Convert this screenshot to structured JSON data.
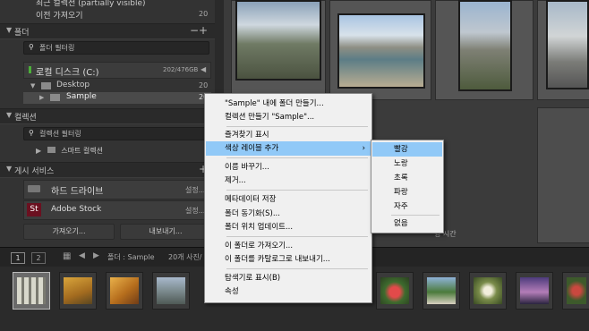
{
  "left_panel": {
    "top_rows": [
      {
        "label": "최근 컬렉션 (partially visible)",
        "count": ""
      },
      {
        "label": "이전 가져오기",
        "count": "20"
      }
    ],
    "folders": {
      "title": "폴더",
      "add": "+",
      "minus": "−",
      "filter": "폴더 필터링",
      "volume": {
        "name": "로컬 디스크 (C:)",
        "size": "202/476GB"
      },
      "items": [
        {
          "name": "Desktop",
          "count": "20"
        },
        {
          "name": "Sample",
          "count": "20"
        }
      ]
    },
    "collections": {
      "title": "컬렉션",
      "filter": "컬렉션 필터링",
      "smart": "스마트 컬렉션"
    },
    "publish": {
      "title": "게시 서비스",
      "services": [
        {
          "name": "하드 드라이브",
          "action": "설정..."
        },
        {
          "name": "Adobe Stock",
          "action": "설정..."
        }
      ]
    },
    "import_button": "가져오기...",
    "export_button": "내보내기..."
  },
  "toolbar": {
    "tab1": "1",
    "tab2": "2",
    "path": "폴더 : Sample",
    "count": "20개 사진/",
    "sort_fragment": "영 시간"
  },
  "context_menu": {
    "items": [
      {
        "label": "\"Sample\" 내에 폴더 만들기..."
      },
      {
        "label": "컬렉션 만들기 \"Sample\"..."
      },
      {
        "label": "즐겨찾기 표시"
      },
      {
        "label": "색상 레이블 추가",
        "submenu": true
      },
      {
        "label": "이름 바꾸기..."
      },
      {
        "label": "제거..."
      },
      {
        "label": "메타데이터 저장"
      },
      {
        "label": "폴더 동기화(S)..."
      },
      {
        "label": "폴더 위치 업데이트..."
      },
      {
        "label": "이 폴더로 가져오기..."
      },
      {
        "label": "이 폴더를 카탈로그로 내보내기..."
      },
      {
        "label": "탐색기로 표시(B)"
      },
      {
        "label": "속성"
      }
    ],
    "submenu_arrow": "›"
  },
  "color_submenu": {
    "items": [
      {
        "label": "빨강"
      },
      {
        "label": "노랑"
      },
      {
        "label": "초록"
      },
      {
        "label": "파랑"
      },
      {
        "label": "자주"
      },
      {
        "label": "없음"
      }
    ]
  },
  "colors": {
    "highlight": "#91c9f7",
    "panel": "#333333",
    "menu_bg": "#f0f0f0"
  }
}
